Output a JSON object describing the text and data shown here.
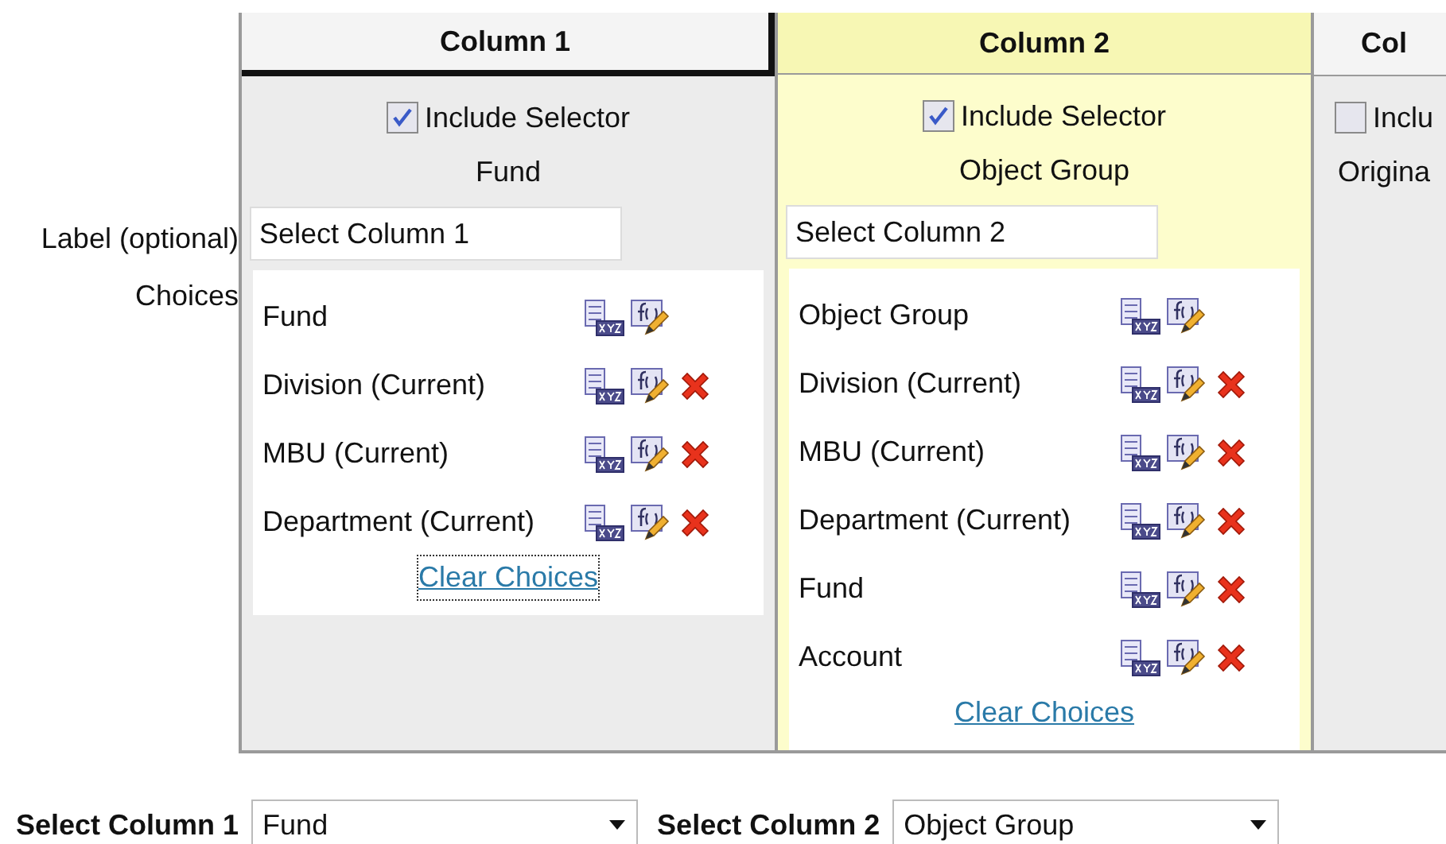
{
  "form": {
    "label_field_label": "Label (optional)",
    "choices_label": "Choices"
  },
  "columns": [
    {
      "title": "Column 1",
      "focused": true,
      "highlighted": false,
      "include_selector": {
        "label": "Include Selector",
        "checked": true
      },
      "current": "Fund",
      "label_field": {
        "value": "Select Column 1"
      },
      "choices": [
        {
          "name": "Fund",
          "removable": false
        },
        {
          "name": "Division (Current)",
          "removable": true
        },
        {
          "name": "MBU (Current)",
          "removable": true
        },
        {
          "name": "Department (Current)",
          "removable": true
        }
      ],
      "clear_link": "Clear Choices"
    },
    {
      "title": "Column 2",
      "focused": false,
      "highlighted": true,
      "include_selector": {
        "label": "Include Selector",
        "checked": true
      },
      "current": "Object Group",
      "label_field": {
        "value": "Select Column 2"
      },
      "choices": [
        {
          "name": "Object Group",
          "removable": false
        },
        {
          "name": "Division (Current)",
          "removable": true
        },
        {
          "name": "MBU (Current)",
          "removable": true
        },
        {
          "name": "Department (Current)",
          "removable": true
        },
        {
          "name": "Fund",
          "removable": true
        },
        {
          "name": "Account",
          "removable": true
        }
      ],
      "clear_link": "Clear Choices"
    },
    {
      "title": "Col",
      "focused": false,
      "highlighted": false,
      "include_selector": {
        "label": "Inclu",
        "checked": false
      },
      "current": "Origina"
    }
  ],
  "selectors": [
    {
      "label": "Select Column 1",
      "value": "Fund"
    },
    {
      "label": "Select Column 2",
      "value": "Object Group"
    }
  ]
}
